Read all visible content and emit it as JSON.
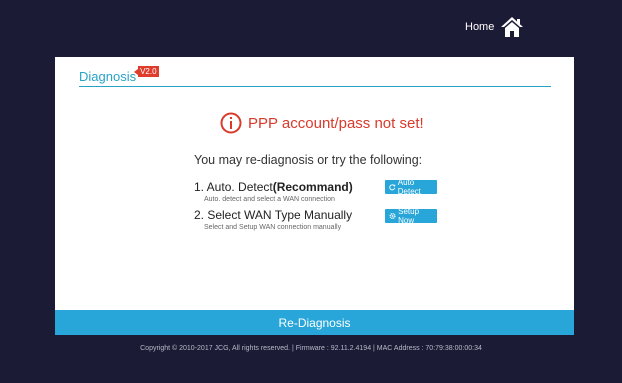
{
  "nav": {
    "home_label": "Home"
  },
  "panel": {
    "title": "Diagnosis",
    "version": "V2.0",
    "alert": "PPP account/pass not set!",
    "intro": "You may re-diagnosis or try the following:",
    "options": [
      {
        "title_prefix": "1. Auto. Detect",
        "title_bold": "(Recommand)",
        "desc": "Auto. detect and select a WAN connection",
        "button": "Auto Detect"
      },
      {
        "title_prefix": "2. Select WAN Type Manually",
        "title_bold": "",
        "desc": "Select and Setup WAN connection manually",
        "button": "Setup Now"
      }
    ],
    "rediagnose": "Re-Diagnosis"
  },
  "footer": {
    "copyright": "Copyright © 2010-2017 JCG, All rights reserved.  |  Firmware : 92.11.2.4194  |  MAC Address : 70:79:38:00:00:34"
  },
  "colors": {
    "accent": "#29a6d9",
    "alert": "#d93a2b",
    "background": "#1c1b36"
  }
}
